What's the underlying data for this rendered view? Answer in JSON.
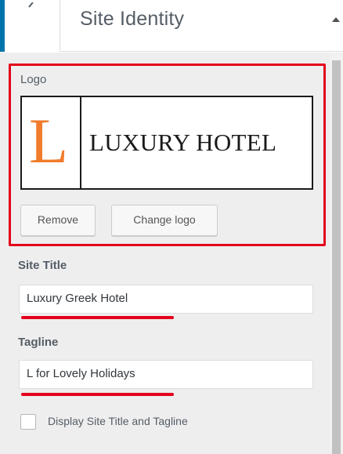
{
  "header": {
    "title": "Site Identity",
    "back_icon": "chevron-left-icon",
    "scroll_icon": "arrow-up-icon"
  },
  "colors": {
    "accent": "#0073aa",
    "highlight": "#e3001b",
    "logo_letter": "#f07c2c"
  },
  "logo": {
    "label": "Logo",
    "preview_letter": "L",
    "preview_text": "LUXURY HOTEL",
    "remove_label": "Remove",
    "change_label": "Change logo"
  },
  "site_title": {
    "label": "Site Title",
    "value": "Luxury Greek Hotel"
  },
  "tagline": {
    "label": "Tagline",
    "value": "L for Lovely Holidays"
  },
  "display_checkbox": {
    "label": "Display Site Title and Tagline",
    "checked": false
  }
}
